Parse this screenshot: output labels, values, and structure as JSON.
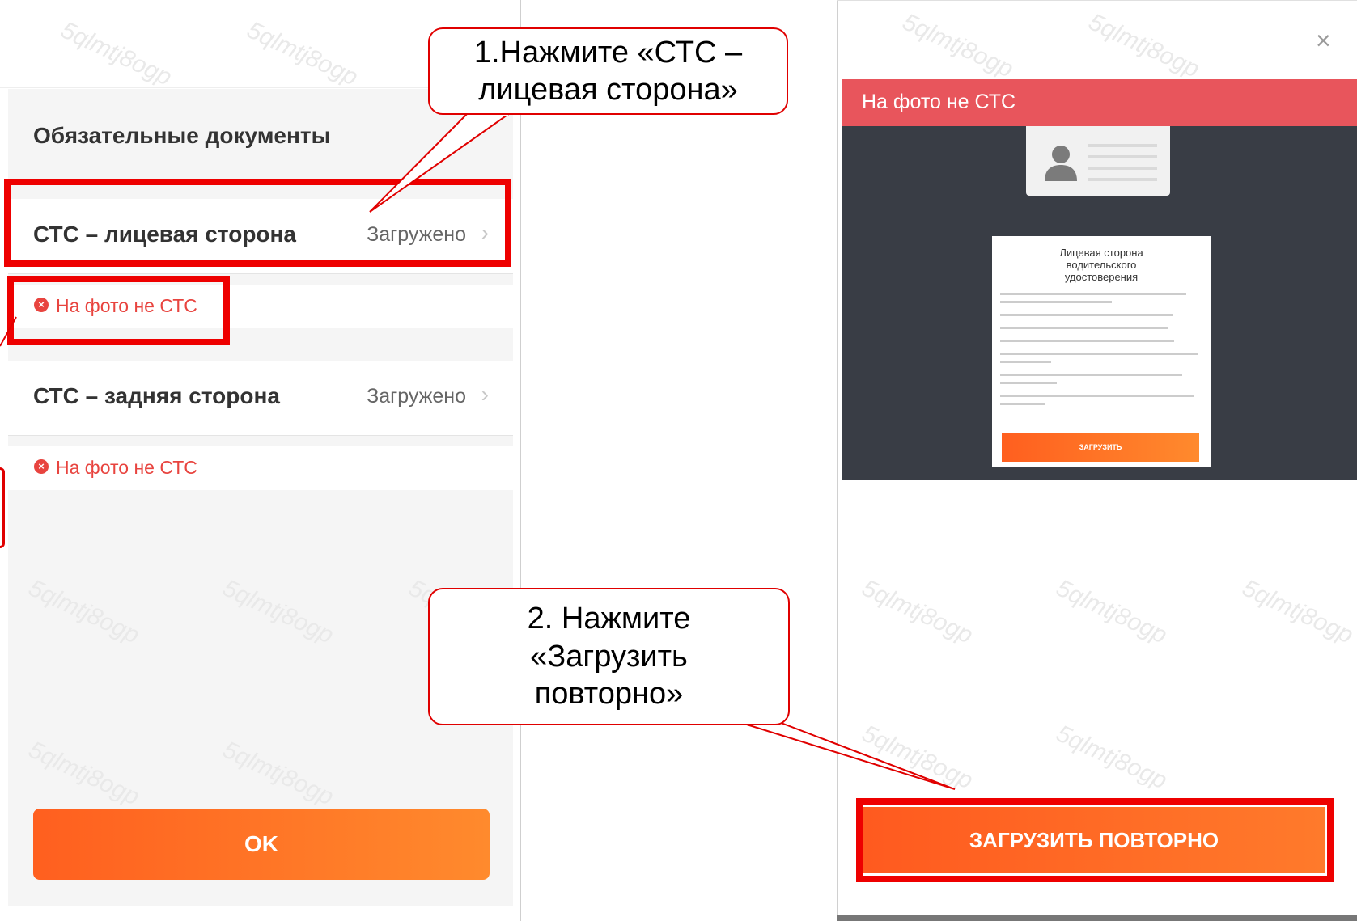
{
  "left_panel": {
    "section_title": "Обязательные документы",
    "documents": [
      {
        "label": "СТС – лицевая сторона",
        "status": "Загружено",
        "error": "На фото не СТС"
      },
      {
        "label": "СТС – задняя сторона",
        "status": "Загружено",
        "error": "На фото не СТС"
      }
    ],
    "ok_label": "OK"
  },
  "right_modal": {
    "error_banner": "На фото не СТС",
    "instruction_title": "Лицевая сторона\nводительского\nудостоверения",
    "instruction_upload_label": "ЗАГРУЗИТЬ",
    "reupload_label": "ЗАГРУЗИТЬ ПОВТОРНО",
    "close_symbol": "×"
  },
  "callouts": {
    "step1": "1.Нажмите «СТС –\nлицевая сторона»",
    "step2": "2. Нажмите\n«Загрузить\nповторно»"
  },
  "watermark_text": "5qlmtj8ogp",
  "colors": {
    "accent_orange": "#ff6a22",
    "error_red": "#e8443f",
    "highlight_red": "#ee0000",
    "banner_red": "#e8555c",
    "dark_preview": "#393d45"
  }
}
